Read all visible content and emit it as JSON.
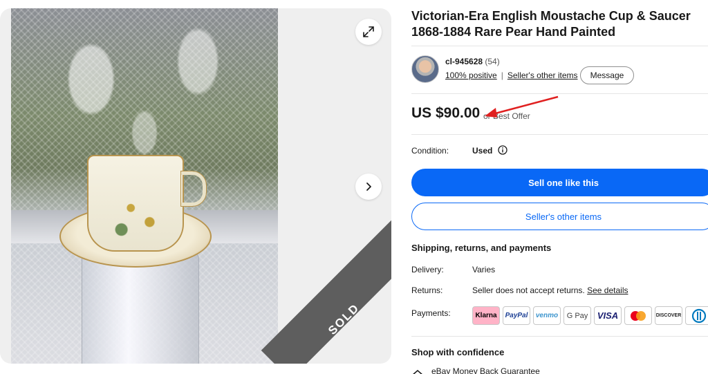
{
  "listing": {
    "title": "Victorian-Era English Moustache Cup & Saucer 1868-1884 Rare Pear Hand Painted",
    "sold_badge": "SOLD"
  },
  "seller": {
    "name": "cl-945628",
    "count": "(54)",
    "feedback": "100% positive",
    "other_items_link": "Seller's other items",
    "message_button": "Message"
  },
  "price": {
    "amount": "US $90.00",
    "offer": "or Best Offer"
  },
  "condition": {
    "label": "Condition:",
    "value": "Used"
  },
  "actions": {
    "primary": "Sell one like this",
    "secondary": "Seller's other items"
  },
  "shipping": {
    "heading": "Shipping, returns, and payments",
    "delivery_label": "Delivery:",
    "delivery_value": "Varies",
    "returns_label": "Returns:",
    "returns_value": "Seller does not accept returns.",
    "returns_link": "See details",
    "payments_label": "Payments:",
    "payment_methods": [
      "Klarna",
      "PayPal",
      "venmo",
      "G Pay",
      "VISA",
      "Mastercard",
      "DISCOVER",
      "Diners Club"
    ]
  },
  "confidence": {
    "heading": "Shop with confidence",
    "guarantee": "eBay Money Back Guarantee"
  },
  "colors": {
    "primary_blue": "#0968f6",
    "annotation_red": "#e02020",
    "sold_band": "#5e5e5e"
  }
}
